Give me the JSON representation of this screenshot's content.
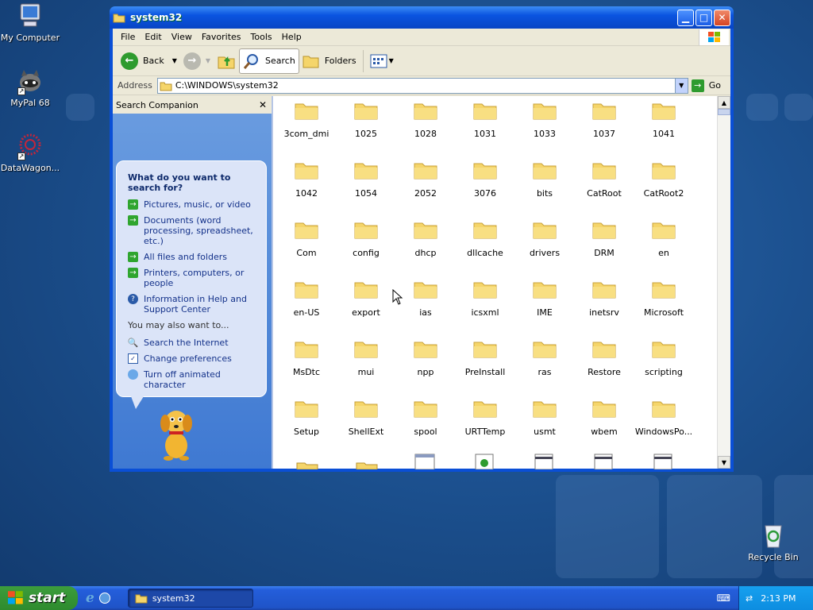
{
  "desktop": {
    "icons": [
      {
        "label": "My Computer",
        "icon": "computer-icon"
      },
      {
        "label": "MyPal 68",
        "icon": "raccoon-icon"
      },
      {
        "label": "DataWagon...",
        "icon": "datawagon-icon"
      },
      {
        "label": "Recycle Bin",
        "icon": "recycle-bin-icon"
      }
    ]
  },
  "window": {
    "title": "system32",
    "menu": [
      "File",
      "Edit",
      "View",
      "Favorites",
      "Tools",
      "Help"
    ],
    "toolbar": {
      "back_label": "Back",
      "search_label": "Search",
      "folders_label": "Folders"
    },
    "address": {
      "label": "Address",
      "value": "C:\\WINDOWS\\system32",
      "go_label": "Go"
    },
    "companion": {
      "header": "Search Companion",
      "question": "What do you want to search for?",
      "options": [
        "Pictures, music, or video",
        "Documents (word processing, spreadsheet, etc.)",
        "All files and folders",
        "Printers, computers, or people",
        "Information in Help and Support Center"
      ],
      "also_label": "You may also want to...",
      "also_options": [
        "Search the Internet",
        "Change preferences",
        "Turn off animated character"
      ]
    },
    "folders": [
      "3com_dmi",
      "1025",
      "1028",
      "1031",
      "1033",
      "1037",
      "1041",
      "1042",
      "1054",
      "2052",
      "3076",
      "bits",
      "CatRoot",
      "CatRoot2",
      "Com",
      "config",
      "dhcp",
      "dllcache",
      "drivers",
      "DRM",
      "en",
      "en-US",
      "export",
      "ias",
      "icsxml",
      "IME",
      "inetsrv",
      "Microsoft",
      "MsDtc",
      "mui",
      "npp",
      "PreInstall",
      "ras",
      "Restore",
      "scripting",
      "Setup",
      "ShellExt",
      "spool",
      "URTTemp",
      "usmt",
      "wbem",
      "WindowsPo..."
    ]
  },
  "taskbar": {
    "start_label": "start",
    "task_label": "system32",
    "clock": "2:13 PM"
  },
  "colors": {
    "folder": "#f5d56a",
    "title_blue": "#0a54e0",
    "start_green": "#2e8b2e"
  }
}
